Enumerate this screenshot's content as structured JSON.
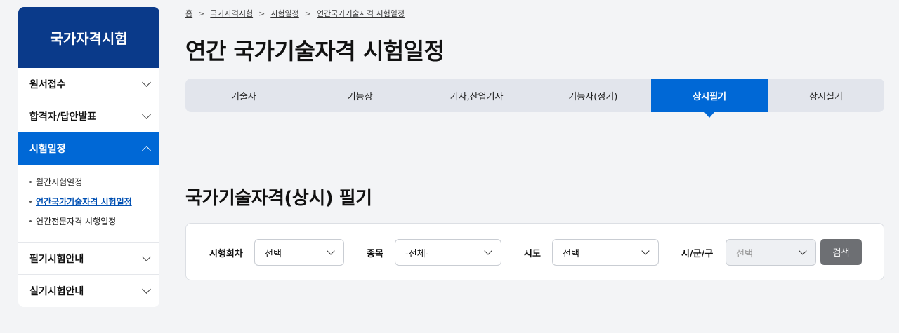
{
  "sidebar": {
    "title": "국가자격시험",
    "items": [
      {
        "label": "원서접수"
      },
      {
        "label": "합격자/답안발표"
      },
      {
        "label": "시험일정"
      },
      {
        "label": "필기시험안내"
      },
      {
        "label": "실기시험안내"
      }
    ],
    "sub_items": [
      {
        "label": "월간시험일정"
      },
      {
        "label": "연간국가기술자격 시험일정"
      },
      {
        "label": "연간전문자격 시행일정"
      }
    ]
  },
  "breadcrumb": [
    "홈",
    "국가자격시험",
    "시험일정",
    "연간국가기술자격 시험일정"
  ],
  "page_title": "연간 국가기술자격 시험일정",
  "tabs": [
    {
      "label": "기술사"
    },
    {
      "label": "기능장"
    },
    {
      "label": "기사,산업기사"
    },
    {
      "label": "기능사(정기)"
    },
    {
      "label": "상시필기"
    },
    {
      "label": "상시실기"
    }
  ],
  "active_tab": "상시필기",
  "section_title": "국가기술자격(상시) 필기",
  "filters": {
    "round_label": "시행회차",
    "round_value": "선택",
    "item_label": "종목",
    "item_value": "-전체-",
    "sido_label": "시도",
    "sido_value": "선택",
    "sigungu_label": "시/군/구",
    "sigungu_value": "선택",
    "search_label": "검색"
  },
  "colors": {
    "brand_dark": "#0a3a8a",
    "accent": "#0068d6",
    "button_gray": "#6d6f73"
  }
}
